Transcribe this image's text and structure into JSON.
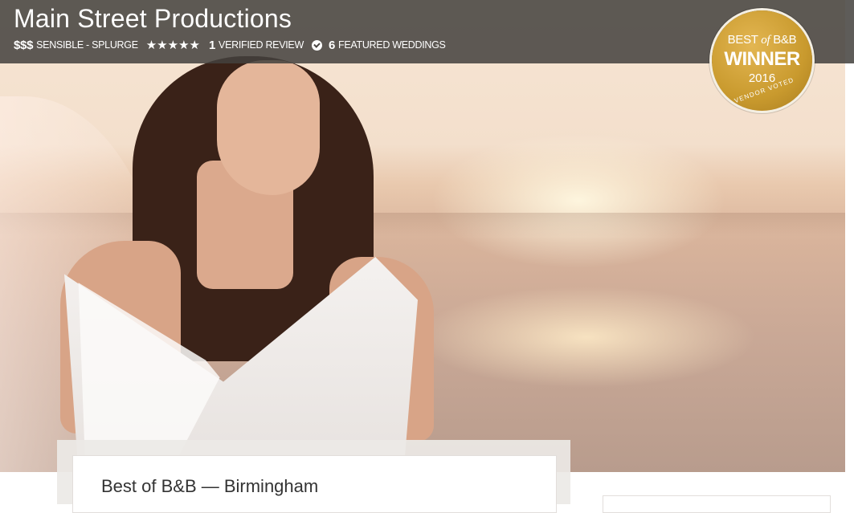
{
  "vendor": {
    "name": "Main Street Productions",
    "price": {
      "symbol": "$$$",
      "label": "SENSIBLE - SPLURGE"
    },
    "rating": {
      "stars": "★★★★★",
      "value": 5,
      "max": 5
    },
    "reviews": {
      "count": "1",
      "label": "VERIFIED REVIEW"
    },
    "weddings": {
      "count": "6",
      "label": "FEATURED WEDDINGS"
    }
  },
  "badge": {
    "line1_prefix": "BEST",
    "line1_of": "of",
    "line1_suffix": "B&B",
    "line2": "WINNER",
    "line3": "2016",
    "line4": "VENDOR VOTED"
  },
  "card": {
    "title": "Best of B&B — Birmingham"
  },
  "hero": {
    "icon": "bride-beach-photo"
  },
  "colors": {
    "topbar": "#44413e",
    "badge_gold": "#c99a2e",
    "text_dark": "#333333"
  }
}
